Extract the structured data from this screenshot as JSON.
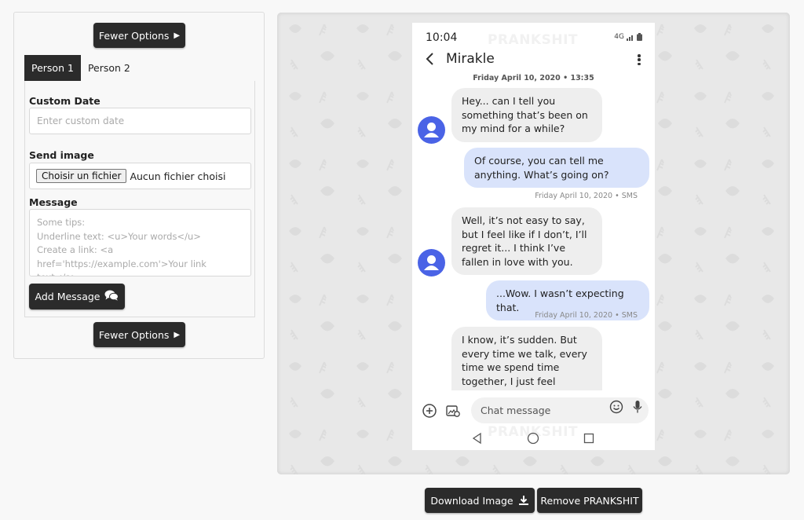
{
  "editor": {
    "fewer_options_label": "Fewer Options",
    "tabs": [
      {
        "label": "Person 1",
        "active": true
      },
      {
        "label": "Person 2",
        "active": false
      }
    ],
    "custom_date": {
      "label": "Custom Date",
      "placeholder": "Enter custom date",
      "value": ""
    },
    "send_image": {
      "label": "Send image",
      "button_label": "Choisir un fichier",
      "status": "Aucun fichier choisi"
    },
    "message": {
      "label": "Message",
      "placeholder": "Some tips:\nUnderline text: <u>Your words</u>\nCreate a link: <a href='https://example.com'>Your link text</a>",
      "value": ""
    },
    "add_message_label": "Add Message"
  },
  "phone": {
    "time": "10:04",
    "network": "4G",
    "watermark": "PRANKSHIT",
    "contact_name": "Mirakle",
    "date_header": "Friday April 10, 2020 • 13:35",
    "messages": [
      {
        "from": "in",
        "text": "Hey... can I tell you something that’s been on my mind for a while?"
      },
      {
        "from": "out",
        "text": "Of course, you can tell me anything. What’s going on?",
        "meta": "Friday April 10, 2020 • SMS"
      },
      {
        "from": "in",
        "text": "Well, it’s not easy to say, but I feel like if I don’t, I’ll regret it... I think I’ve fallen in love with you."
      },
      {
        "from": "out",
        "text": "...Wow. I wasn’t expecting that.",
        "meta": "Friday April 10, 2020 • SMS"
      },
      {
        "from": "in",
        "text": "I know, it’s sudden. But every time we talk, every time we spend time together, I just feel"
      }
    ],
    "composer_placeholder": "Chat message"
  },
  "actions": {
    "download_label": "Download Image",
    "remove_label": "Remove PRANKSHIT"
  },
  "colors": {
    "dark_button": "#2b2b2b",
    "avatar": "#4a63e6",
    "incoming_bubble": "#eeeeee",
    "outgoing_bubble": "#d9e3fb"
  }
}
